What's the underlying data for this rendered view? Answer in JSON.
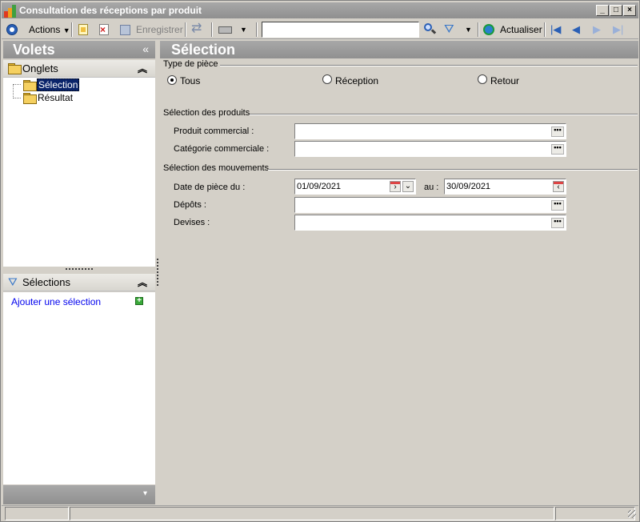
{
  "window": {
    "title": "Consultation des réceptions par produit"
  },
  "toolbar": {
    "actions_label": "Actions",
    "save_label": "Enregistrer",
    "refresh_label": "Actualiser",
    "search_value": ""
  },
  "left_panel": {
    "header": "Volets",
    "tabs_section": "Onglets",
    "tree_items": [
      "Sélection",
      "Résultat"
    ],
    "selections_section": "Sélections",
    "add_selection_link": "Ajouter une sélection"
  },
  "main": {
    "header": "Sélection",
    "piece_type": {
      "title": "Type de pièce",
      "options": [
        "Tous",
        "Réception",
        "Retour"
      ],
      "selected": "Tous"
    },
    "products": {
      "title": "Sélection des produits",
      "commercial_product_label": "Produit commercial :",
      "commercial_product_value": "",
      "commercial_category_label": "Catégorie commerciale :",
      "commercial_category_value": ""
    },
    "movements": {
      "title": "Sélection des mouvements",
      "date_from_label": "Date de pièce du :",
      "date_from_value": "01/09/2021",
      "date_to_label": "au :",
      "date_to_value": "30/09/2021",
      "depots_label": "Dépôts :",
      "depots_value": "",
      "currencies_label": "Devises :",
      "currencies_value": ""
    }
  },
  "icons": {
    "dots_glyph": "•••",
    "collapse_left": "«",
    "collapse_up": "⌃",
    "expand_down": "▾"
  },
  "colors": {
    "header_gradient_top": "#a8a8a8",
    "selection_highlight": "#0a246a",
    "link": "#0000ee"
  }
}
